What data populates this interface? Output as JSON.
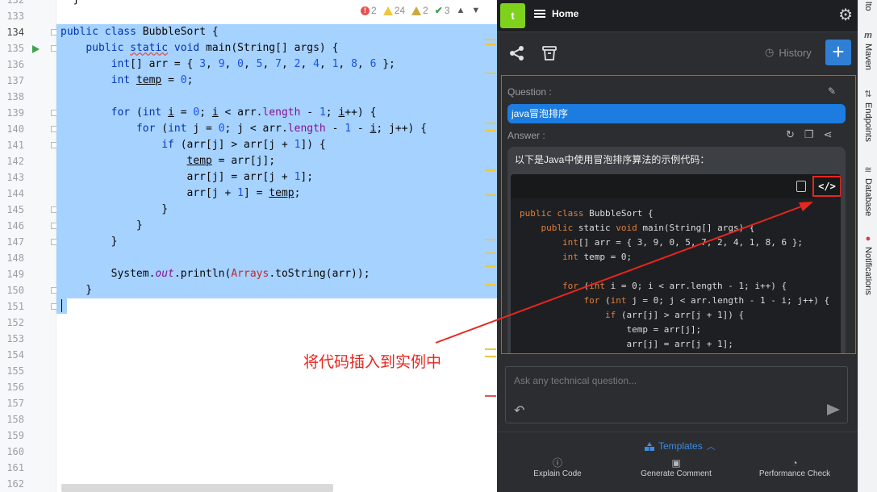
{
  "editor": {
    "inspections": {
      "errors": "2",
      "warnings": "24",
      "weak_warnings": "2",
      "ok": "3"
    },
    "lines": [
      {
        "n": "132",
        "html": "  }"
      },
      {
        "n": "133",
        "html": ""
      },
      {
        "n": "134",
        "html": "<span class='kw'>public class</span> BubbleSort {"
      },
      {
        "n": "135",
        "html": "    <span class='kw'>public</span> <span class='kw uw'>static</span> <span class='kw'>void</span> main(String[] args) {"
      },
      {
        "n": "136",
        "html": "        <span class='kw'>int</span>[] arr = { <span class='num'>3</span>, <span class='num'>9</span>, <span class='num'>0</span>, <span class='num'>5</span>, <span class='num'>7</span>, <span class='num'>2</span>, <span class='num'>4</span>, <span class='num'>1</span>, <span class='num'>8</span>, <span class='num'>6</span> };"
      },
      {
        "n": "137",
        "html": "        <span class='kw'>int</span> <span class='ul'>temp</span> = <span class='num'>0</span>;"
      },
      {
        "n": "138",
        "html": ""
      },
      {
        "n": "139",
        "html": "        <span class='kw'>for</span> (<span class='kw'>int</span> <span class='ul'>i</span> = <span class='num'>0</span>; <span class='ul'>i</span> &lt; arr.<span class='fld'>length</span> - <span class='num'>1</span>; <span class='ul'>i</span>++) {"
      },
      {
        "n": "140",
        "html": "            <span class='kw'>for</span> (<span class='kw'>int</span> j = <span class='num'>0</span>; j &lt; arr.<span class='fld'>length</span> - <span class='num'>1</span> - <span class='ul'>i</span>; j++) {"
      },
      {
        "n": "141",
        "html": "                <span class='kw'>if</span> (arr[j] &gt; arr[j + <span class='num'>1</span>]) {"
      },
      {
        "n": "142",
        "html": "                    <span class='ul'>temp</span> = arr[j];"
      },
      {
        "n": "143",
        "html": "                    arr[j] = arr[j + <span class='num'>1</span>];"
      },
      {
        "n": "144",
        "html": "                    arr[j + <span class='num'>1</span>] = <span class='ul'>temp</span>;"
      },
      {
        "n": "145",
        "html": "                }"
      },
      {
        "n": "146",
        "html": "            }"
      },
      {
        "n": "147",
        "html": "        }"
      },
      {
        "n": "148",
        "html": ""
      },
      {
        "n": "149",
        "html": "        System.<span class='st'>out</span>.println(<span class='cls'>Arrays</span>.toString(arr));"
      },
      {
        "n": "150",
        "html": "    }"
      },
      {
        "n": "151",
        "html": "}"
      },
      {
        "n": "152",
        "html": ""
      },
      {
        "n": "153",
        "html": ""
      },
      {
        "n": "154",
        "html": ""
      },
      {
        "n": "155",
        "html": ""
      },
      {
        "n": "156",
        "html": ""
      },
      {
        "n": "157",
        "html": ""
      },
      {
        "n": "158",
        "html": ""
      },
      {
        "n": "159",
        "html": ""
      },
      {
        "n": "160",
        "html": ""
      },
      {
        "n": "161",
        "html": ""
      },
      {
        "n": "162",
        "html": ""
      }
    ]
  },
  "panel": {
    "logo": "t",
    "home_tab": "Home",
    "history_label": "History",
    "question_label": "Question :",
    "question_text": "java冒泡排序",
    "answer_label": "Answer :",
    "answer_intro": "以下是Java中使用冒泡排序算法的示例代码：",
    "insert_icon": "</>",
    "code_lines": [
      "<span class='pk'>public class</span> BubbleSort {",
      "    <span class='pk'>public</span> static <span class='pk'>void</span> main(String[] args) {",
      "        <span class='pk'>int</span>[] arr = { 3, 9, 0, 5, 7, 2, 4, 1, 8, 6 };",
      "        <span class='pk'>int</span> temp = 0;",
      "",
      "        <span class='pk'>for</span> (<span class='pk'>int</span> i = 0; i &lt; arr.length - 1; i++) {",
      "            <span class='pk'>for</span> (<span class='pk'>int</span> j = 0; j &lt; arr.length - 1 - i; j++) {",
      "                <span class='pk'>if</span> (arr[j] &gt; arr[j + 1]) {",
      "                    temp = arr[j];",
      "                    arr[j] = arr[j + 1];"
    ],
    "prompt_placeholder": "Ask any technical question...",
    "templates_label": "Templates",
    "actions": {
      "explain": "Explain Code",
      "comment": "Generate Comment",
      "perf": "Performance Check"
    }
  },
  "toolstrip": {
    "top": "lto",
    "maven": "Maven",
    "endpoints": "Endpoints",
    "database": "Database",
    "notifications": "Notifications"
  },
  "annotation": {
    "text": "将代码插入到实例中",
    "color": "#e8261f"
  }
}
